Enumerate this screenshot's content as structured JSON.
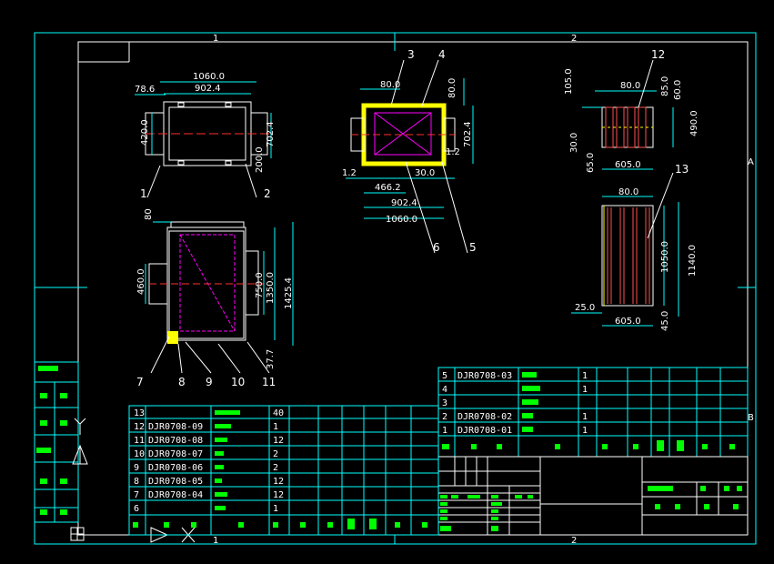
{
  "grid": {
    "top_1": "1",
    "top_2": "2",
    "bottom_1": "1",
    "bottom_2": "2",
    "right_A": "A",
    "right_B": "B"
  },
  "view1": {
    "dim_width": "1060.0",
    "dim_inner": "902.4",
    "dim_left": "78.6",
    "dim_h": "420.0",
    "dim_right": "702.4",
    "dim_small": "200.0",
    "tag_1": "1",
    "tag_2": "2"
  },
  "view2": {
    "dim_top": "80.0",
    "dim_right_top": "80.0",
    "dim_right": "702.4",
    "dim_a": "1.2",
    "dim_b": "30.0",
    "dim_c": "1.2",
    "dim_d": "466.2",
    "dim_e": "902.4",
    "dim_f": "1060.0",
    "tag_3": "3",
    "tag_4": "4",
    "tag_5": "5",
    "tag_6": "6"
  },
  "view3": {
    "dim_top": "80.0",
    "dim_85": "85.0",
    "dim_60": "60.0",
    "dim_105": "105.0",
    "dim_490": "490.0",
    "dim_30": "30.0",
    "dim_65": "65.0",
    "dim_605": "605.0",
    "tag_12": "12"
  },
  "view4": {
    "dim_top": "80.0",
    "dim_1050": "1050.0",
    "dim_1140": "1140.0",
    "dim_25": "25.0",
    "dim_605": "605.0",
    "dim_45": "45.0",
    "tag_13": "13"
  },
  "view5": {
    "dim_80": "80",
    "dim_460": "460.0",
    "dim_750": "750.0",
    "dim_1350": "1350.0",
    "dim_1425": "1425.4",
    "dim_37": "37.7",
    "tags": [
      "7",
      "8",
      "9",
      "10",
      "11"
    ]
  },
  "bom_right": [
    {
      "no": "5",
      "code": "DJR0708-03",
      "qty": "1"
    },
    {
      "no": "4",
      "code": "",
      "qty": "1"
    },
    {
      "no": "3",
      "code": "",
      "qty": ""
    },
    {
      "no": "2",
      "code": "DJR0708-02",
      "qty": "1"
    },
    {
      "no": "1",
      "code": "DJR0708-01",
      "qty": "1"
    }
  ],
  "bom_left": [
    {
      "no": "13",
      "code": "",
      "qty": "40"
    },
    {
      "no": "12",
      "code": "DJR0708-09",
      "qty": "1"
    },
    {
      "no": "11",
      "code": "DJR0708-08",
      "qty": "12"
    },
    {
      "no": "10",
      "code": "DJR0708-07",
      "qty": "2"
    },
    {
      "no": "9",
      "code": "DJR0708-06",
      "qty": "2"
    },
    {
      "no": "8",
      "code": "DJR0708-05",
      "qty": "12"
    },
    {
      "no": "7",
      "code": "DJR0708-04",
      "qty": "12"
    },
    {
      "no": "6",
      "code": "",
      "qty": "1"
    }
  ]
}
